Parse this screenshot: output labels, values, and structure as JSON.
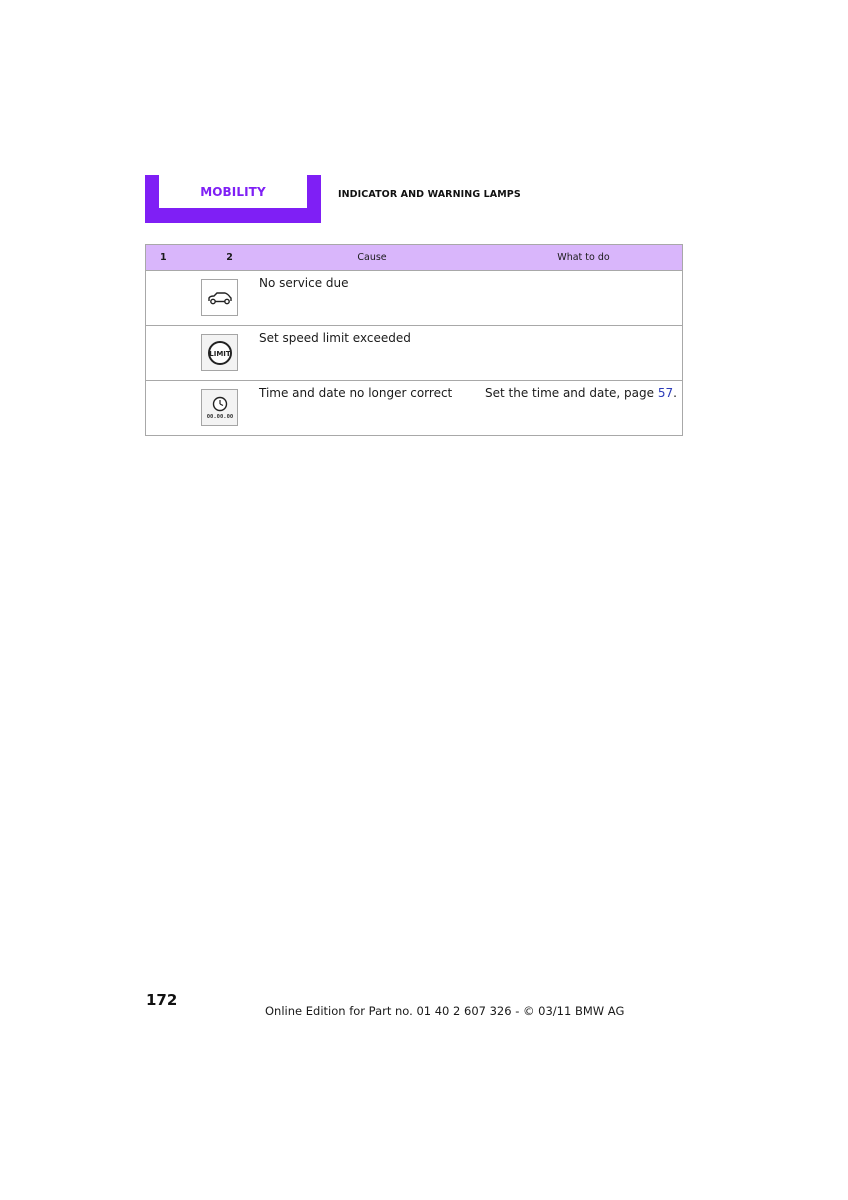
{
  "header": {
    "section_label": "MOBILITY",
    "chapter_title": "INDICATOR AND WARNING LAMPS",
    "accent_color": "#7f1ff5",
    "table_header_color": "#d9b6fb"
  },
  "table": {
    "columns": [
      "1",
      "2",
      "Cause",
      "What to do"
    ],
    "rows": [
      {
        "icon": "car-service-icon",
        "cause": "No service due",
        "what_to_do": ""
      },
      {
        "icon": "speed-limit-icon",
        "icon_text": "LIMIT",
        "cause": "Set speed limit exceeded",
        "what_to_do": ""
      },
      {
        "icon": "clock-icon",
        "icon_text": "00.00.00",
        "cause": "Time and date no longer correct",
        "what_to_do": "Set the time and date, page ",
        "what_to_do_link": "57",
        "what_to_do_suffix": "."
      }
    ]
  },
  "footer": {
    "page_number": "172",
    "edition_text": "Online Edition for Part no. 01 40 2 607 326 - © 03/11 BMW AG"
  }
}
